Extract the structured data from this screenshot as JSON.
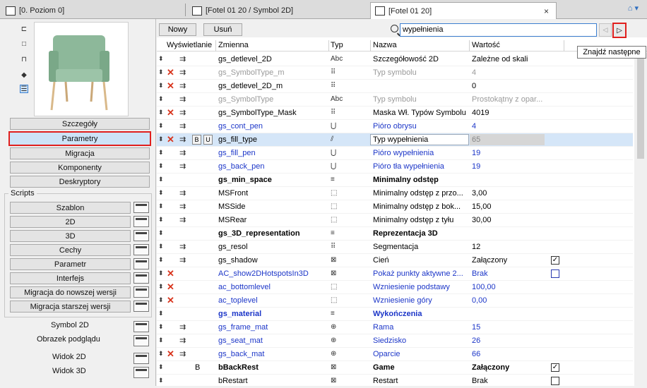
{
  "tabs": [
    {
      "label": "[0. Poziom 0]"
    },
    {
      "label": "[Fotel 01 20 / Symbol 2D]"
    },
    {
      "label": "[Fotel 01 20]",
      "close": "×"
    }
  ],
  "sidebar": {
    "buttons": [
      "Szczegóły",
      "Parametry",
      "Migracja",
      "Komponenty",
      "Deskryptory"
    ],
    "selected": "Parametry",
    "scripts_label": "Scripts",
    "scripts": [
      "Szablon",
      "2D",
      "3D",
      "Cechy",
      "Parametr",
      "Interfejs",
      "Migracja do nowszej wersji",
      "Migracja starszej wersji"
    ],
    "extras": [
      "Symbol 2D",
      "Obrazek podglądu",
      "Widok 2D",
      "Widok 3D"
    ]
  },
  "toolbar": {
    "new_label": "Nowy",
    "delete_label": "Usuń",
    "search_value": "wypełnienia",
    "tooltip": "Znajdź następne"
  },
  "columns": {
    "display": "Wyświetlanie",
    "variable": "Zmienna",
    "type": "Typ",
    "name": "Nazwa",
    "value": "Wartość"
  },
  "rows": [
    {
      "var": "gs_detlevel_2D",
      "type": "Abc",
      "name": "Szczegółowość 2D",
      "value": "Zależne od skali",
      "x": false,
      "style": "normal"
    },
    {
      "var": "gs_SymbolType_m",
      "type": "⠿",
      "name": "Typ symbolu",
      "value": "4",
      "x": true,
      "style": "gray"
    },
    {
      "var": "gs_detlevel_2D_m",
      "type": "⠿",
      "name": "",
      "value": "0",
      "x": true,
      "style": "normal"
    },
    {
      "var": "gs_SymbolType",
      "type": "Abc",
      "name": "Typ symbolu",
      "value": "Prostokątny z opar...",
      "x": false,
      "style": "gray"
    },
    {
      "var": "gs_SymbolType_Mask",
      "type": "⠿",
      "name": "Maska Wł. Typów Symbolu",
      "value": "4019",
      "x": true,
      "style": "normal"
    },
    {
      "var": "gs_cont_pen",
      "type": "pen",
      "name": "Pióro obrysu",
      "value": "4",
      "x": false,
      "style": "blue"
    },
    {
      "var": "gs_fill_type",
      "type": "fill",
      "name": "Typ wypełnienia",
      "value": "65",
      "x": true,
      "style": "selected",
      "flags": [
        "B",
        "U"
      ]
    },
    {
      "var": "gs_fill_pen",
      "type": "pen",
      "name": "Pióro wypełnienia",
      "value": "19",
      "x": false,
      "style": "blue"
    },
    {
      "var": "gs_back_pen",
      "type": "pen",
      "name": "Pióro tła wypełnienia",
      "value": "19",
      "x": false,
      "style": "blue"
    },
    {
      "var": "gs_min_space",
      "type": "title",
      "name": "Minimalny odstęp",
      "value": "",
      "x": false,
      "style": "bold",
      "noindent": true
    },
    {
      "var": "MSFront",
      "type": "len",
      "name": "Minimalny odstęp z przo...",
      "value": "3,00",
      "x": false,
      "style": "normal"
    },
    {
      "var": "MSSide",
      "type": "len",
      "name": "Minimalny odstęp z bok...",
      "value": "15,00",
      "x": false,
      "style": "normal"
    },
    {
      "var": "MSRear",
      "type": "len",
      "name": "Minimalny odstęp z tyłu",
      "value": "30,00",
      "x": false,
      "style": "normal"
    },
    {
      "var": "gs_3D_representation",
      "type": "title",
      "name": "Reprezentacja 3D",
      "value": "",
      "x": false,
      "style": "bold",
      "noindent": true
    },
    {
      "var": "gs_resol",
      "type": "⠿",
      "name": "Segmentacja",
      "value": "12",
      "x": false,
      "style": "normal"
    },
    {
      "var": "gs_shadow",
      "type": "bool",
      "name": "Cień",
      "value": "Załączony",
      "x": false,
      "style": "normal",
      "check": "✓"
    },
    {
      "var": "AC_show2DHotspotsIn3D",
      "type": "bool",
      "name": "Pokaż punkty aktywne 2...",
      "value": "Brak",
      "x": true,
      "style": "blue",
      "check": "",
      "noindent": true
    },
    {
      "var": "ac_bottomlevel",
      "type": "len",
      "name": "Wzniesienie podstawy",
      "value": "100,00",
      "x": true,
      "style": "blue",
      "noindent": true
    },
    {
      "var": "ac_toplevel",
      "type": "len",
      "name": "Wzniesienie góry",
      "value": "0,00",
      "x": true,
      "style": "blue",
      "noindent": true
    },
    {
      "var": "gs_material",
      "type": "title",
      "name": "Wykończenia",
      "value": "",
      "x": false,
      "style": "boldblue",
      "noindent": true
    },
    {
      "var": "gs_frame_mat",
      "type": "mat",
      "name": "Rama",
      "value": "15",
      "x": false,
      "style": "blue"
    },
    {
      "var": "gs_seat_mat",
      "type": "mat",
      "name": "Siedzisko",
      "value": "26",
      "x": false,
      "style": "blue"
    },
    {
      "var": "gs_back_mat",
      "type": "mat",
      "name": "Oparcie",
      "value": "66",
      "x": true,
      "style": "blue"
    },
    {
      "var": "bBackRest",
      "type": "bool",
      "name": "Game",
      "value": "Załączony",
      "x": false,
      "style": "bold",
      "check": "✓",
      "noindent": true,
      "flagB": "B"
    },
    {
      "var": "bRestart",
      "type": "bool",
      "name": "Restart",
      "value": "Brak",
      "x": false,
      "style": "normal",
      "check": "",
      "noindent": true
    }
  ]
}
